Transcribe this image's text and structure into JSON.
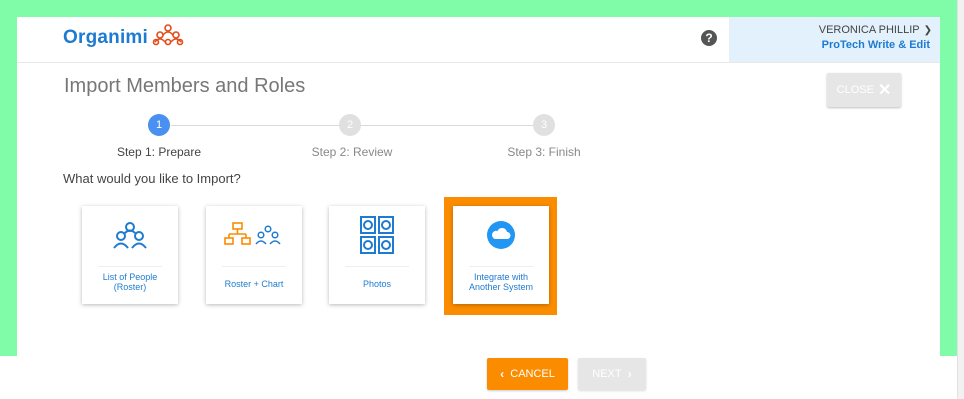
{
  "header": {
    "logo_text": "Organimi",
    "help_glyph": "?",
    "user_name": "VERONICA PHILLIP",
    "user_org": "ProTech Write & Edit",
    "accent_color": "#1e7bd1"
  },
  "page": {
    "title": "Import Members and Roles",
    "close_label": "CLOSE"
  },
  "stepper": {
    "steps": [
      {
        "number": "1",
        "label": "Step 1: Prepare",
        "active": true
      },
      {
        "number": "2",
        "label": "Step 2: Review",
        "active": false
      },
      {
        "number": "3",
        "label": "Step 3: Finish",
        "active": false
      }
    ],
    "active_color": "#4a90f0",
    "inactive_color": "#e0e0e0"
  },
  "import": {
    "question": "What would you like to Import?",
    "options": [
      {
        "label": "List of People (Roster)",
        "icon": "people-icon",
        "selected": false
      },
      {
        "label": "Roster + Chart",
        "icon": "org-chart-people-icon",
        "selected": false
      },
      {
        "label": "Photos",
        "icon": "photo-grid-icon",
        "selected": false
      },
      {
        "label": "Integrate with Another System",
        "icon": "cloud-icon",
        "selected": true
      }
    ],
    "highlight_color": "#fb8c00"
  },
  "footer": {
    "cancel_label": "CANCEL",
    "next_label": "NEXT"
  }
}
